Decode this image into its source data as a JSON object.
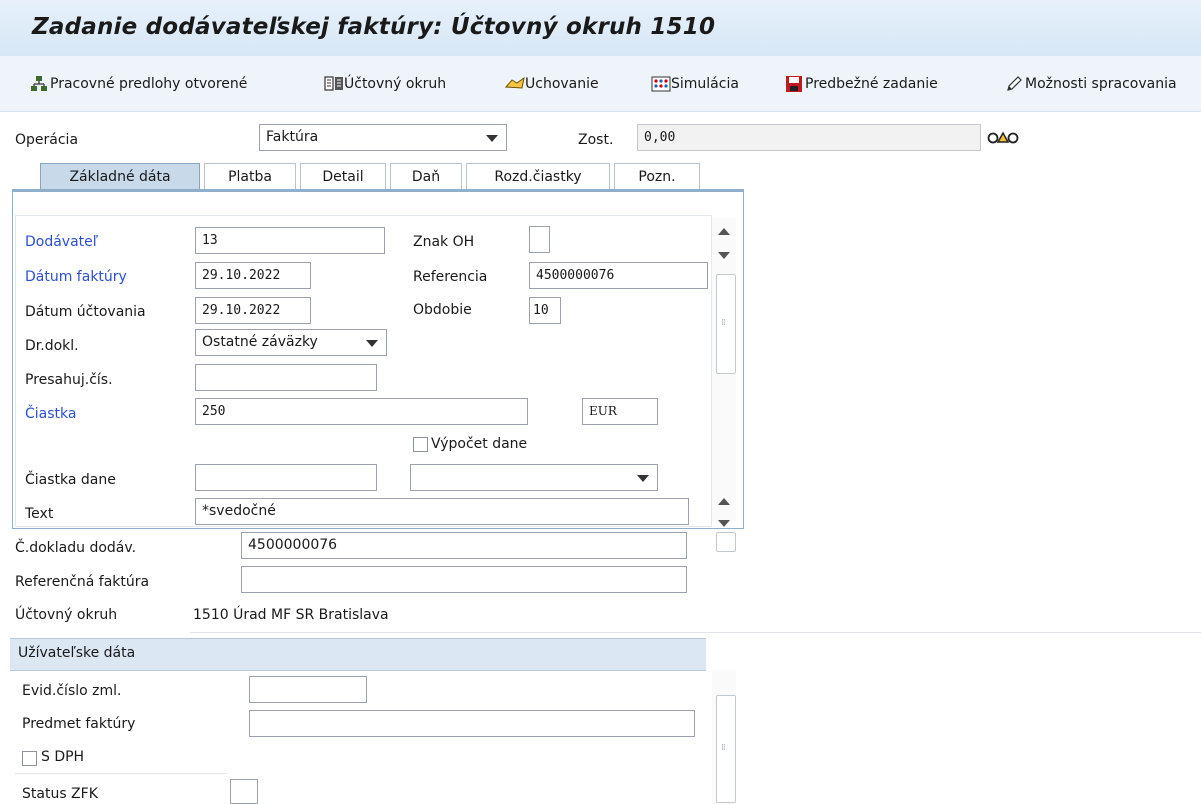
{
  "window": {
    "title": "Zadanie dodávateľskej faktúry: Účtovný okruh 1510"
  },
  "toolbar": {
    "items": [
      {
        "label": "Pracovné predlohy otvorené",
        "icon": "tree-structure-icon"
      },
      {
        "label": "Účtovný okruh",
        "icon": "company-code-icon"
      },
      {
        "label": "Uchovanie",
        "icon": "hold-icon"
      },
      {
        "label": "Simulácia",
        "icon": "simulate-icon"
      },
      {
        "label": "Predbežné zadanie",
        "icon": "save-park-icon"
      },
      {
        "label": "Možnosti spracovania",
        "icon": "pencil-icon"
      }
    ]
  },
  "header": {
    "operation_label": "Operácia",
    "operation_value": "Faktúra",
    "balance_label": "Zost.",
    "balance_value": "0,00",
    "status_icon": "traffic-light-icon"
  },
  "tabs": [
    {
      "label": "Základné dáta",
      "active": true
    },
    {
      "label": "Platba",
      "active": false
    },
    {
      "label": "Detail",
      "active": false
    },
    {
      "label": "Daň",
      "active": false
    },
    {
      "label": "Rozd.čiastky",
      "active": false
    },
    {
      "label": "Pozn.",
      "active": false
    }
  ],
  "basic": {
    "vendor_label": "Dodávateľ",
    "vendor_value": "13",
    "invoice_date_label": "Dátum faktúry",
    "invoice_date_value": "29.10.2022",
    "posting_date_label": "Dátum účtovania",
    "posting_date_value": "29.10.2022",
    "doc_type_label": "Dr.dokl.",
    "doc_type_value": "Ostatné záväzky",
    "cross_cc_label": "Presahuj.čís.",
    "cross_cc_value": "",
    "amount_label": "Čiastka",
    "amount_value": "250",
    "currency_value": "EUR",
    "calc_tax_label": "Výpočet dane",
    "tax_amount_label": "Čiastka dane",
    "tax_amount_value": "",
    "tax_code_value": "",
    "text_label": "Text",
    "text_value": "*svedočné",
    "sgl_label": "Znak OH",
    "sgl_value": "",
    "reference_label": "Referencia",
    "reference_value": "4500000076",
    "period_label": "Obdobie",
    "period_value": "10"
  },
  "lower": {
    "vendor_doc_label": "Č.dokladu dodáv.",
    "vendor_doc_value": "4500000076",
    "ref_invoice_label": "Referenčná faktúra",
    "ref_invoice_value": "",
    "company_code_label": "Účtovný okruh",
    "company_code_value": "1510 Úrad MF SR Bratislava"
  },
  "user_data": {
    "title": "Užívateľske dáta",
    "contract_label": "Evid.číslo zml.",
    "contract_value": "",
    "subject_label": "Predmet faktúry",
    "subject_value": "",
    "vat_label": "S DPH",
    "status_label": "Status ZFK",
    "status_value": ""
  },
  "colors": {
    "required_label": "#2b4fd1",
    "title_bar": "#dce9f6",
    "tab_active": "#c8d9ea",
    "section_header": "#dbe7f3"
  }
}
